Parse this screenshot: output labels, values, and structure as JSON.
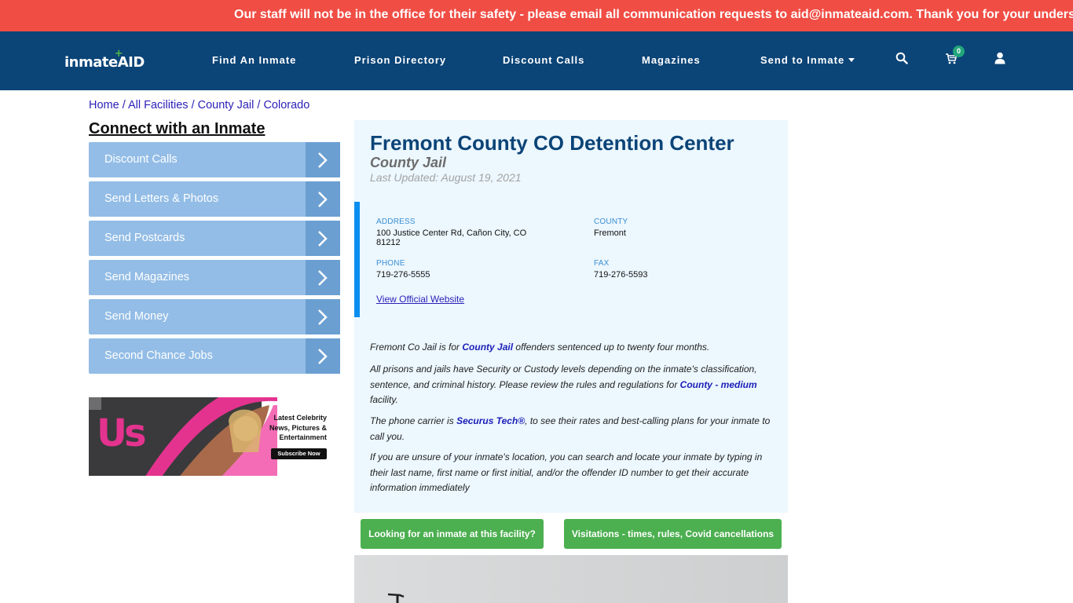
{
  "alert": {
    "text": "Our staff will not be in the office for their safety - please email all communication requests to aid@inmateaid.com. Thank you for your understanding."
  },
  "header": {
    "logo": {
      "part1": "inmate",
      "part2": "AID",
      "plus": "+"
    },
    "nav": [
      {
        "label": "Find An Inmate"
      },
      {
        "label": "Prison Directory"
      },
      {
        "label": "Discount Calls"
      },
      {
        "label": "Magazines"
      },
      {
        "label": "Send to Inmate",
        "has_dropdown": true
      }
    ],
    "icons": [
      "search-icon",
      "cart-icon",
      "user-icon"
    ],
    "cart_count": "0"
  },
  "breadcrumb": {
    "items": [
      "Home",
      "All Facilities",
      "County Jail",
      "Colorado"
    ],
    "separator": "/"
  },
  "sidebar": {
    "title": "Connect with an Inmate",
    "items": [
      {
        "label": "Discount Calls"
      },
      {
        "label": "Send Letters & Photos"
      },
      {
        "label": "Send Postcards"
      },
      {
        "label": "Send Magazines"
      },
      {
        "label": "Send Money"
      },
      {
        "label": "Second Chance Jobs"
      }
    ],
    "ad": {
      "brand": "Us",
      "headline_lines": [
        "Latest Celebrity",
        "News, Pictures &",
        "Entertainment"
      ],
      "cta": "Subscribe Now"
    }
  },
  "facility": {
    "title": "Fremont County CO Detention Center",
    "type": "County Jail",
    "last_updated": "Last Updated: August 19, 2021",
    "info": {
      "address_label": "ADDRESS",
      "address_line1": "100 Justice Center Rd, Cañon City, CO",
      "address_line2": "81212",
      "county_label": "COUNTY",
      "county": "Fremont",
      "phone_label": "PHONE",
      "phone": "719-276-5555",
      "fax_label": "FAX",
      "fax": "719-276-5593",
      "website_link": "View Official Website"
    },
    "description": {
      "p1_before": "Fremont Co Jail is for ",
      "p1_link": "County Jail",
      "p1_after": " offenders sentenced up to twenty four months.",
      "p2_before": "All prisons and jails have Security or Custody levels depending on the inmate's classification, sentence, and criminal history. Please review the rules and regulations for ",
      "p2_link": "County - medium",
      "p2_after": " facility.",
      "p3_before": "The phone carrier is ",
      "p3_link": "Securus Tech®",
      "p3_after": ", to see their rates and best-calling plans for your inmate to call you.",
      "p4": "If you are unsure of your inmate's location, you can search and locate your inmate by typing in their last name, first name or first initial, and/or the offender ID number to get their accurate information immediately"
    },
    "buttons": {
      "find_inmate": "Looking for an inmate at this facility?",
      "visitations": "Visitations - times, rules, Covid cancellations"
    }
  },
  "colors": {
    "alert_bg": "#f04d44",
    "nav_bg": "#0b4477",
    "sidebar_item": "#93bde6",
    "sidebar_arrow": "#6b9fd2",
    "panel_bg": "#ecf7fe",
    "info_accent": "#0a8ef0",
    "green_button": "#4caf50",
    "cart_badge": "#21a67a"
  }
}
